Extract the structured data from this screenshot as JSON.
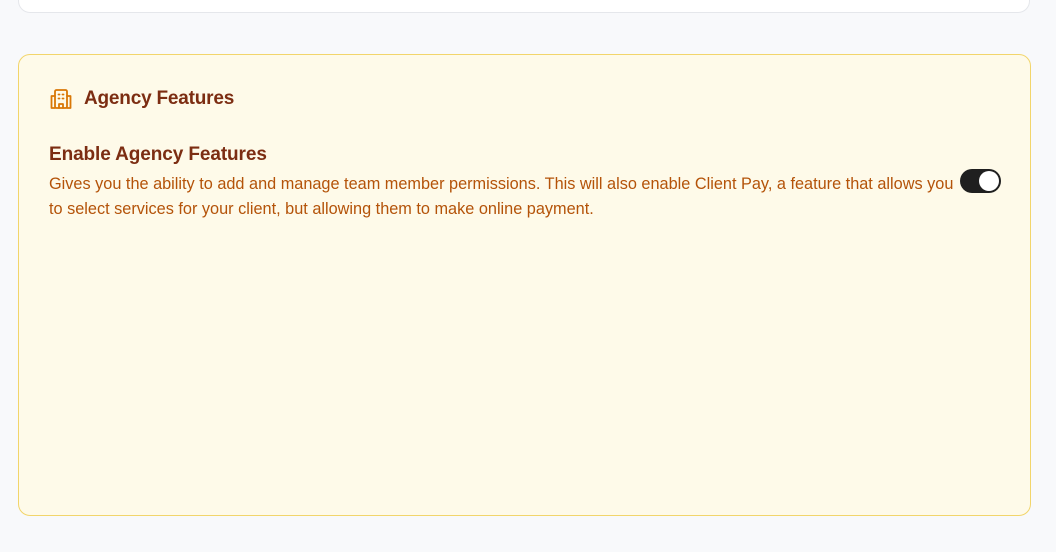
{
  "agency": {
    "title": "Agency Features",
    "icon": "building-icon",
    "setting": {
      "title": "Enable Agency Features",
      "description": "Gives you the ability to add and manage team member permissions. This will also enable Client Pay, a feature that allows you to select services for your client, but allowing them to make online payment.",
      "enabled": true
    }
  },
  "colors": {
    "card_bg": "#fefae9",
    "card_border": "#f2d56b",
    "title_color": "#7c2d12",
    "desc_color": "#b45309",
    "icon_color": "#d97706",
    "toggle_on": "#1f1f1f"
  }
}
